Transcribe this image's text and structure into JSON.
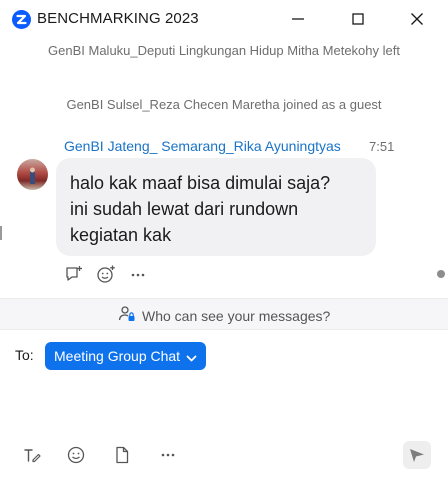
{
  "window": {
    "title": "BENCHMARKING 2023"
  },
  "chat": {
    "system_messages": [
      "GenBI Maluku_Deputi Lingkungan Hidup Mitha Metekohy left",
      "GenBI Sulsel_Reza Checen Maretha joined as a guest"
    ],
    "message": {
      "sender": "GenBI Jateng_ Semarang_Rika Ayuningtyas",
      "time": "7:51",
      "text": "halo kak maaf bisa dimulai saja?\nini sudah lewat dari rundown\nkegiatan kak"
    },
    "reaction_icons": [
      "reply-icon",
      "add-emoji-icon",
      "more-icon"
    ]
  },
  "privacy": {
    "label": "Who can see your messages?"
  },
  "recipient": {
    "to_label": "To:",
    "selected": "Meeting Group Chat"
  },
  "composer": {
    "value": "",
    "placeholder": ""
  },
  "toolbar": {
    "icons": [
      "format-text-icon",
      "emoji-icon",
      "file-icon",
      "more-icon",
      "send-icon"
    ]
  },
  "colors": {
    "accent": "#0e72ed",
    "sender_name": "#1a73c7",
    "bubble": "#f1f1f4"
  }
}
